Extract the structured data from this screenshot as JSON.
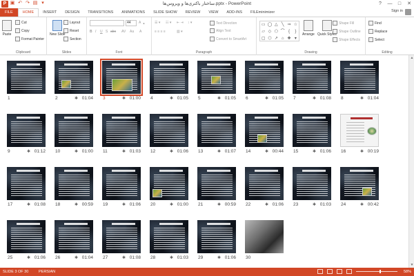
{
  "window": {
    "title": "ساختار باکتری‌ها و ویروس‌ها.pptx - PowerPoint",
    "controls": [
      "?",
      "—",
      "□",
      "✕"
    ]
  },
  "tabs": [
    {
      "label": "FILE"
    },
    {
      "label": "HOME"
    },
    {
      "label": "INSERT"
    },
    {
      "label": "DESIGN"
    },
    {
      "label": "TRANSITIONS"
    },
    {
      "label": "ANIMATIONS"
    },
    {
      "label": "SLIDE SHOW"
    },
    {
      "label": "REVIEW"
    },
    {
      "label": "VIEW"
    },
    {
      "label": "ADD-INS"
    },
    {
      "label": "FILEminimizer"
    }
  ],
  "account": {
    "signin": "Sign in"
  },
  "ribbon": {
    "clipboard": {
      "paste": "Paste",
      "cut": "Cut",
      "copy": "Copy",
      "format_painter": "Format Painter",
      "label": "Clipboard"
    },
    "slides": {
      "new_slide": "New Slide",
      "layout": "Layout",
      "reset": "Reset",
      "section": "Section",
      "label": "Slides"
    },
    "font": {
      "size": "44",
      "label": "Font"
    },
    "paragraph": {
      "text_direction": "Text Direction",
      "align_text": "Align Text",
      "convert_smartart": "Convert to SmartArt",
      "label": "Paragraph"
    },
    "drawing": {
      "arrange": "Arrange",
      "quick_styles": "Quick Styles",
      "shape_fill": "Shape Fill",
      "shape_outline": "Shape Outline",
      "shape_effects": "Shape Effects",
      "label": "Drawing"
    },
    "editing": {
      "find": "Find",
      "replace": "Replace",
      "select": "Select",
      "label": "Editing"
    }
  },
  "slides": [
    {
      "num": "1",
      "time": ""
    },
    {
      "num": "2",
      "time": "01:04"
    },
    {
      "num": "3",
      "time": "01:00"
    },
    {
      "num": "4",
      "time": "01:05"
    },
    {
      "num": "5",
      "time": "01:05"
    },
    {
      "num": "6",
      "time": "01:05"
    },
    {
      "num": "7",
      "time": "01:08"
    },
    {
      "num": "8",
      "time": "01:04"
    },
    {
      "num": "9",
      "time": "01:12"
    },
    {
      "num": "10",
      "time": "01:00"
    },
    {
      "num": "11",
      "time": "01:03"
    },
    {
      "num": "12",
      "time": "01:06"
    },
    {
      "num": "13",
      "time": "01:07"
    },
    {
      "num": "14",
      "time": "00:44"
    },
    {
      "num": "15",
      "time": "01:06"
    },
    {
      "num": "16",
      "time": "00:19"
    },
    {
      "num": "17",
      "time": "01:08"
    },
    {
      "num": "18",
      "time": "00:59"
    },
    {
      "num": "19",
      "time": "01:06"
    },
    {
      "num": "20",
      "time": "01:00"
    },
    {
      "num": "21",
      "time": "00:59"
    },
    {
      "num": "22",
      "time": "01:06"
    },
    {
      "num": "23",
      "time": "01:03"
    },
    {
      "num": "24",
      "time": "00:42"
    },
    {
      "num": "25",
      "time": "01:06"
    },
    {
      "num": "26",
      "time": "01:04"
    },
    {
      "num": "27",
      "time": "01:08"
    },
    {
      "num": "28",
      "time": "01:03"
    },
    {
      "num": "29",
      "time": "01:06"
    },
    {
      "num": "30",
      "time": ""
    }
  ],
  "selected_slide": 3,
  "statusbar": {
    "slide_info": "SLIDE 3 OF 30",
    "language": "PERSIAN",
    "zoom": "58%",
    "zoom_fraction": 0.58
  },
  "colors": {
    "accent": "#d24726",
    "thumb_bg": "#141a22"
  }
}
